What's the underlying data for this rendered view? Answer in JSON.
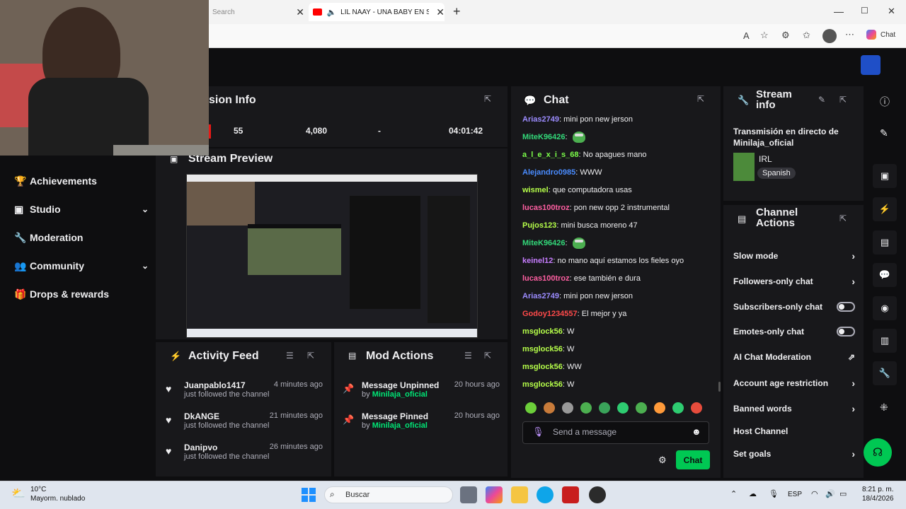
{
  "browser": {
    "tab1_label": "Search",
    "tab2_label": "LIL NAAY - UNA BABY EN SAN",
    "new_tab_icon": "plus-icon",
    "copilot_label": "Chat"
  },
  "session": {
    "title": "sion Info",
    "stats": [
      "55",
      "4,080",
      "-",
      "04:01:42"
    ]
  },
  "stream_preview": {
    "title": "Stream Preview"
  },
  "sidebar": {
    "items": [
      {
        "label": "Achievements",
        "icon": "trophy-icon",
        "chevron": false
      },
      {
        "label": "Studio",
        "icon": "camera-icon",
        "chevron": true
      },
      {
        "label": "Moderation",
        "icon": "wrench-icon",
        "chevron": false
      },
      {
        "label": "Community",
        "icon": "people-icon",
        "chevron": true
      },
      {
        "label": "Drops & rewards",
        "icon": "gift-icon",
        "chevron": false
      }
    ]
  },
  "activity_feed": {
    "title": "Activity Feed",
    "items": [
      {
        "name": "Juanpablo1417",
        "desc": "just followed the channel",
        "time": "4 minutes ago"
      },
      {
        "name": "DkANGE",
        "desc": "just followed the channel",
        "time": "21 minutes ago"
      },
      {
        "name": "Danipvo",
        "desc": "just followed the channel",
        "time": "26 minutes ago"
      }
    ]
  },
  "mod_actions": {
    "title": "Mod Actions",
    "items": [
      {
        "action": "Message Unpinned",
        "by_prefix": "by",
        "by": "Minilaja_oficial",
        "time": "20 hours ago"
      },
      {
        "action": "Message Pinned",
        "by_prefix": "by",
        "by": "Minilaja_oficial",
        "time": "20 hours ago"
      }
    ]
  },
  "chat": {
    "title": "Chat",
    "messages": [
      {
        "user": "Arias2749",
        "color": "#9c8cff",
        "text": "mini pon new jerson"
      },
      {
        "user": "MiteK96426",
        "color": "#33d97a",
        "text": "",
        "emote": true
      },
      {
        "user": "a_l_e_x_i_s_68",
        "color": "#7cff4a",
        "text": "No apagues mano"
      },
      {
        "user": "Alejandro0985",
        "color": "#4a8cff",
        "text": "WWW"
      },
      {
        "user": "wismel",
        "color": "#b6ff4a",
        "text": "que computadora usas"
      },
      {
        "user": "lucas100troz",
        "color": "#ff5fa2",
        "text": "pon new opp 2 instrumental"
      },
      {
        "user": "Pujos123",
        "color": "#b6ff4a",
        "text": "mini busca moreno 47"
      },
      {
        "user": "MiteK96426",
        "color": "#33d97a",
        "text": "",
        "emote": true
      },
      {
        "user": "keinel12",
        "color": "#c77dff",
        "text": "no mano aquí estamos los fieles oyo"
      },
      {
        "user": "lucas100troz",
        "color": "#ff5fa2",
        "text": "ese también e dura"
      },
      {
        "user": "Arias2749",
        "color": "#9c8cff",
        "text": "mini pon new jerson"
      },
      {
        "user": "Godoy1234557",
        "color": "#ff4a4a",
        "text": "El mejor y ya"
      },
      {
        "user": "msglock56",
        "color": "#b6ff4a",
        "text": "W"
      },
      {
        "user": "msglock56",
        "color": "#b6ff4a",
        "text": "W"
      },
      {
        "user": "msglock56",
        "color": "#b6ff4a",
        "text": "WW"
      },
      {
        "user": "msglock56",
        "color": "#b6ff4a",
        "text": "W"
      }
    ],
    "placeholder": "Send a message",
    "send_label": "Chat"
  },
  "stream_info": {
    "title": "Stream info",
    "stream_title": "Transmisión en directo de Minilaja_oficial",
    "category": "IRL",
    "tag": "Spanish"
  },
  "channel_actions": {
    "title": "Channel Actions",
    "items": [
      {
        "label": "Slow mode",
        "type": "chevron"
      },
      {
        "label": "Followers-only chat",
        "type": "chevron"
      },
      {
        "label": "Subscribers-only chat",
        "type": "toggle"
      },
      {
        "label": "Emotes-only chat",
        "type": "toggle"
      },
      {
        "label": "AI Chat Moderation",
        "type": "external"
      },
      {
        "label": "Account age restriction",
        "type": "chevron"
      },
      {
        "label": "Banned words",
        "type": "chevron"
      },
      {
        "label": "Host Channel",
        "type": "none"
      },
      {
        "label": "Set goals",
        "type": "chevron"
      }
    ]
  },
  "taskbar": {
    "weather_temp": "10°C",
    "weather_desc": "Mayorm. nublado",
    "search_placeholder": "Buscar",
    "lang": "ESP",
    "time": "8:21 p. m.",
    "date": "18/4/2026"
  },
  "colors": {
    "accent_green": "#00c853",
    "twitch_bg": "#0e0e10",
    "panel": "#18181b"
  }
}
